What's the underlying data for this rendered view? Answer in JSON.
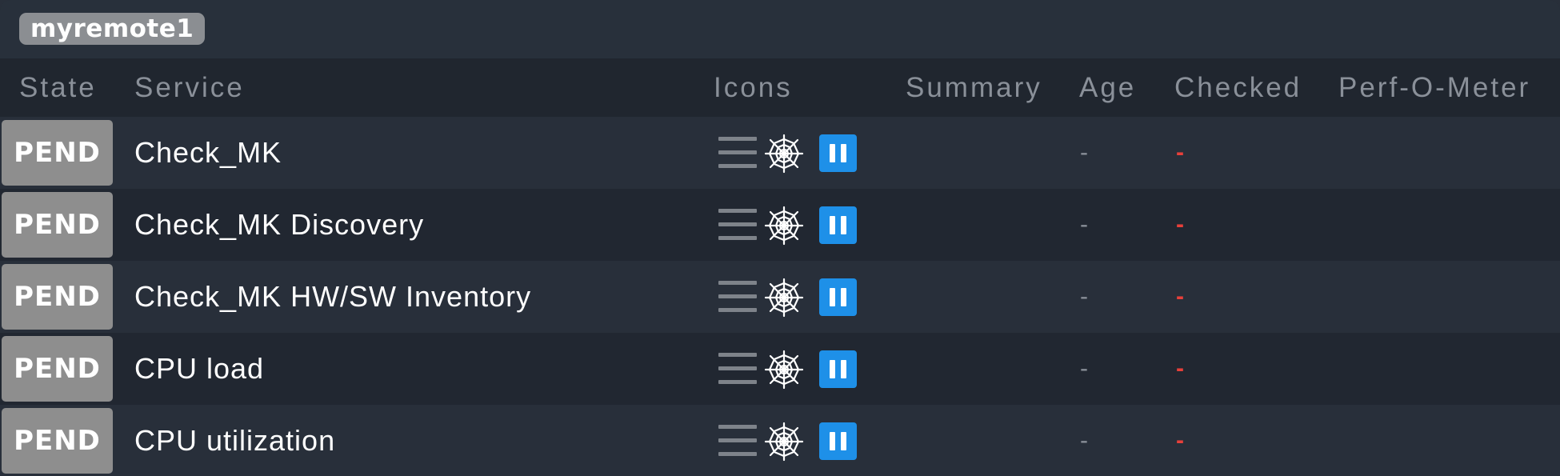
{
  "host": {
    "name": "myremote1"
  },
  "columns": {
    "state": "State",
    "service": "Service",
    "icons": "Icons",
    "summary": "Summary",
    "age": "Age",
    "checked": "Checked",
    "perfometer": "Perf-O-Meter"
  },
  "rows": [
    {
      "state": "PEND",
      "service": "Check_MK",
      "icons": [
        "menu-icon",
        "spiderweb-icon",
        "pause-icon"
      ],
      "summary": "",
      "age": "-",
      "checked": "-"
    },
    {
      "state": "PEND",
      "service": "Check_MK Discovery",
      "icons": [
        "menu-icon",
        "spiderweb-icon",
        "pause-icon"
      ],
      "summary": "",
      "age": "-",
      "checked": "-"
    },
    {
      "state": "PEND",
      "service": "Check_MK HW/SW Inventory",
      "icons": [
        "menu-icon",
        "spiderweb-icon",
        "pause-icon"
      ],
      "summary": "",
      "age": "-",
      "checked": "-"
    },
    {
      "state": "PEND",
      "service": "CPU load",
      "icons": [
        "menu-icon",
        "spiderweb-icon",
        "pause-icon"
      ],
      "summary": "",
      "age": "-",
      "checked": "-"
    },
    {
      "state": "PEND",
      "service": "CPU utilization",
      "icons": [
        "menu-icon",
        "spiderweb-icon",
        "pause-icon"
      ],
      "summary": "",
      "age": "-",
      "checked": "-"
    }
  ],
  "colors": {
    "pending_state": "#8e8e8e",
    "pause_icon": "#1e90e8",
    "checked_stale": "#e8403a",
    "background": "#282f3a",
    "header_background": "#20262f"
  }
}
